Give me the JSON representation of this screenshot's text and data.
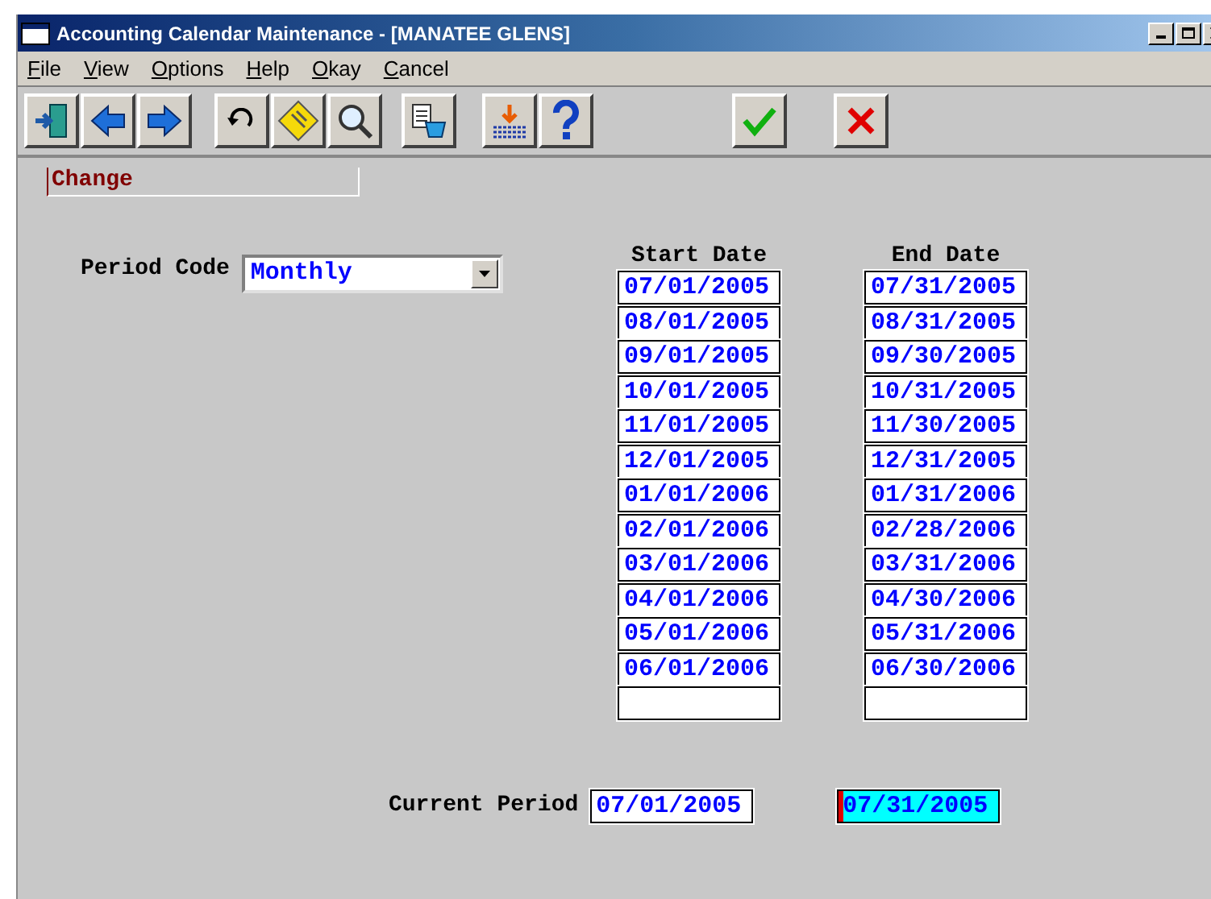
{
  "window": {
    "title": "Accounting Calendar Maintenance - [MANATEE GLENS]"
  },
  "menu": [
    {
      "label": "File"
    },
    {
      "label": "View"
    },
    {
      "label": "Options"
    },
    {
      "label": "Help"
    },
    {
      "label": "Okay"
    },
    {
      "label": "Cancel"
    }
  ],
  "mode_field": {
    "value": "Change"
  },
  "period_code": {
    "label": "Period Code",
    "value": "Monthly"
  },
  "periods": {
    "columns": [
      "Start Date",
      "End Date"
    ],
    "rows": [
      {
        "start": "07/01/2005",
        "end": "07/31/2005"
      },
      {
        "start": "08/01/2005",
        "end": "08/31/2005"
      },
      {
        "start": "09/01/2005",
        "end": "09/30/2005"
      },
      {
        "start": "10/01/2005",
        "end": "10/31/2005"
      },
      {
        "start": "11/01/2005",
        "end": "11/30/2005"
      },
      {
        "start": "12/01/2005",
        "end": "12/31/2005"
      },
      {
        "start": "01/01/2006",
        "end": "01/31/2006"
      },
      {
        "start": "02/01/2006",
        "end": "02/28/2006"
      },
      {
        "start": "03/01/2006",
        "end": "03/31/2006"
      },
      {
        "start": "04/01/2006",
        "end": "04/30/2006"
      },
      {
        "start": "05/01/2006",
        "end": "05/31/2006"
      },
      {
        "start": "06/01/2006",
        "end": "06/30/2006"
      }
    ]
  },
  "current_period": {
    "label": "Current Period",
    "start": "07/01/2005",
    "end": "07/31/2005",
    "end_focused": true
  }
}
